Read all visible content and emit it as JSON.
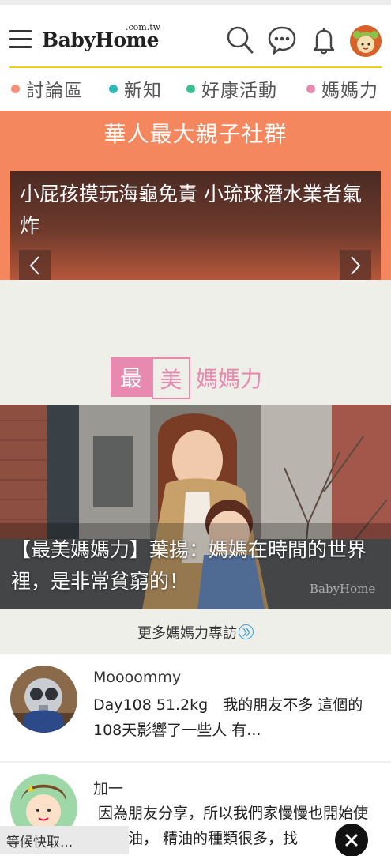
{
  "header": {
    "logo_main": "BabyHome",
    "logo_domain": ".com.tw",
    "icons": [
      "menu-icon",
      "search-icon",
      "chat-icon",
      "bell-icon",
      "user-avatar"
    ],
    "accent_color": "#f1d21b"
  },
  "nav": {
    "items": [
      {
        "label": "討論區",
        "color": "#f4917c"
      },
      {
        "label": "新知",
        "color": "#2fb6b9"
      },
      {
        "label": "好康活動",
        "color": "#3bbf8f"
      },
      {
        "label": "媽媽力",
        "color": "#e889b0"
      }
    ]
  },
  "banner": {
    "title": "華人最大親子社群",
    "slide_text": "小屁孩摸玩海龜免責 小琉球潛水業者氣炸",
    "prev_icon": "chevron-left-icon",
    "next_icon": "chevron-right-icon",
    "bg_color": "#f4875e"
  },
  "section": {
    "box1": "最",
    "box2": "美",
    "rest": "媽媽力",
    "color": "#e889b0"
  },
  "hero": {
    "caption": "【最美媽媽力】葉揚：媽媽在時間的世界裡，是非常貧窮的！",
    "watermark": "BabyHome"
  },
  "more": {
    "label": "更多媽媽力專訪",
    "icon": "circle-chevron-right-icon"
  },
  "posts": [
    {
      "name": "Moooommy",
      "body": "Day108 51.2kg　我的朋友不多 這個的108天影響了一些人 有..."
    },
    {
      "name": "加一",
      "body": "因為朋友分享，所以我們家慢慢也開始使用精油， 精油的種類很多，找"
    }
  ],
  "footer": {
    "loading_text": "等候快取...",
    "close_icon": "close-icon"
  }
}
